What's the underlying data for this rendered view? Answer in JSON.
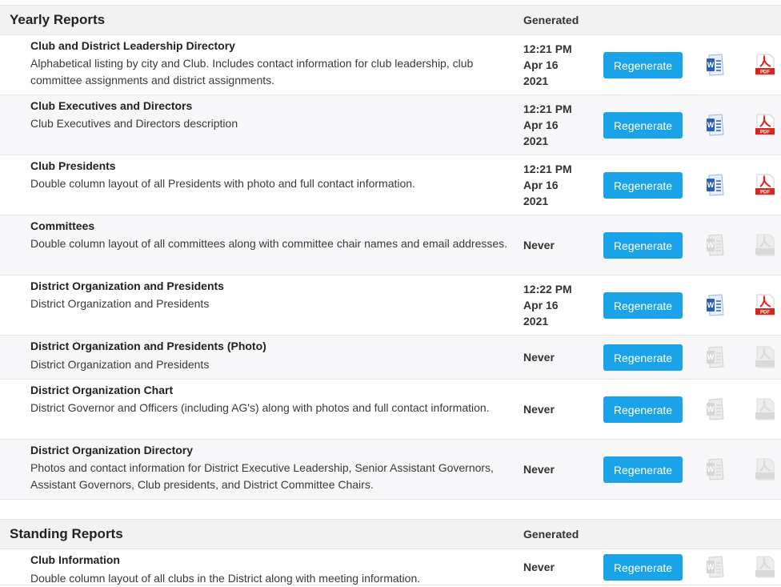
{
  "yearly": {
    "title": "Yearly Reports",
    "generated_header": "Generated",
    "reports": [
      {
        "title": "Club and District Leadership Directory",
        "desc": "Alphabetical listing by city and Club. Includes contact information for club leadership, club committee assignments and district assignments.",
        "gen": [
          "12:21 PM",
          "Apr 16",
          "2021"
        ],
        "has_files": true
      },
      {
        "title": "Club Executives and Directors",
        "desc": "Club Executives and Directors description",
        "gen": [
          "12:21 PM",
          "Apr 16",
          "2021"
        ],
        "has_files": true
      },
      {
        "title": "Club Presidents",
        "desc": "Double column layout of all Presidents with photo and full contact information.",
        "gen": [
          "12:21 PM",
          "Apr 16",
          "2021"
        ],
        "has_files": true
      },
      {
        "title": "Committees",
        "desc": "Double column layout of all committees along with committee chair names and email addresses.",
        "gen": [
          "Never"
        ],
        "has_files": false
      },
      {
        "title": "District Organization and Presidents",
        "desc": "District Organization and Presidents",
        "gen": [
          "12:22 PM",
          "Apr 16",
          "2021"
        ],
        "has_files": true
      },
      {
        "title": "District Organization and Presidents (Photo)",
        "desc": "District Organization and Presidents",
        "gen": [
          "Never"
        ],
        "has_files": false
      },
      {
        "title": "District Organization Chart",
        "desc": "District Governor and Officers (including AG's) along with photos and full contact information.",
        "gen": [
          "Never"
        ],
        "has_files": false
      },
      {
        "title": "District Organization Directory",
        "desc": "Photos and contact information for District Executive Leadership, Senior Assistant Governors, Assistant Governors, Club presidents, and District Committee Chairs.",
        "gen": [
          "Never"
        ],
        "has_files": false
      }
    ]
  },
  "standing": {
    "title": "Standing Reports",
    "generated_header": "Generated",
    "reports": [
      {
        "title": "Club Information",
        "desc": "Double column layout of all clubs in the District along with meeting information.",
        "gen": [
          "Never"
        ],
        "has_files": false
      }
    ]
  },
  "regenerate_label": "Regenerate",
  "colors": {
    "button": "#1aa3e8",
    "word": "#2b5fb3",
    "pdf": "#d9261c",
    "disabled": "#d6d6d6"
  },
  "icons": {
    "word": "word-doc-icon",
    "pdf": "pdf-doc-icon"
  }
}
